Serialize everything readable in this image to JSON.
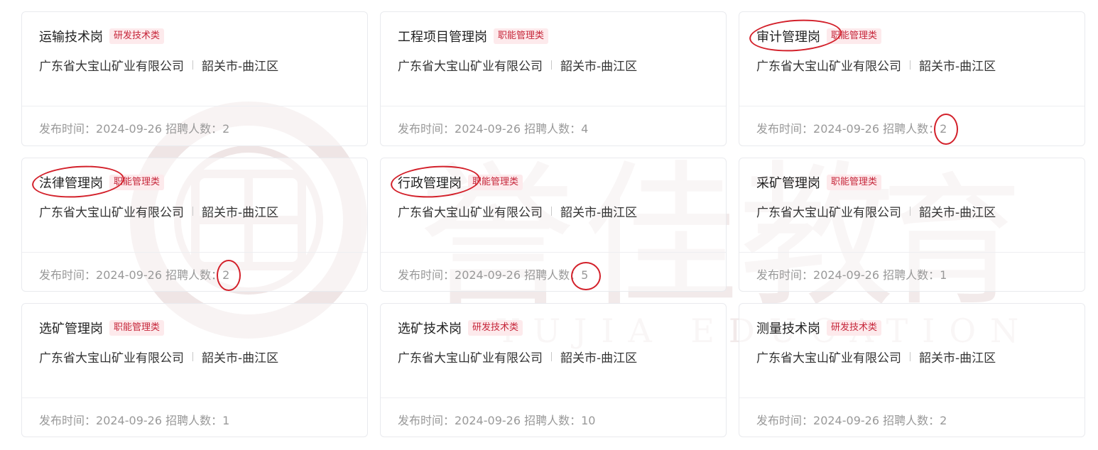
{
  "watermark": {
    "chars": [
      "誉",
      "佳",
      "教",
      "育"
    ],
    "latin": "YUJIA EDUCATION"
  },
  "colors": {
    "tag_text": "#c6263a",
    "tag_bg": "#fdeaec",
    "annotation": "#d3202a",
    "meta": "#999999"
  },
  "labels": {
    "publish_prefix": "发布时间：",
    "headcount_prefix": "招聘人数："
  },
  "jobs": [
    {
      "title": "运输技术岗",
      "tag": "研发技术类",
      "company": "广东省大宝山矿业有限公司",
      "location": "韶关市-曲江区",
      "date": "2024-09-26",
      "headcount": "2"
    },
    {
      "title": "工程项目管理岗",
      "tag": "职能管理类",
      "company": "广东省大宝山矿业有限公司",
      "location": "韶关市-曲江区",
      "date": "2024-09-26",
      "headcount": "4"
    },
    {
      "title": "审计管理岗",
      "tag": "职能管理类",
      "company": "广东省大宝山矿业有限公司",
      "location": "韶关市-曲江区",
      "date": "2024-09-26",
      "headcount": "2"
    },
    {
      "title": "法律管理岗",
      "tag": "职能管理类",
      "company": "广东省大宝山矿业有限公司",
      "location": "韶关市-曲江区",
      "date": "2024-09-26",
      "headcount": "2"
    },
    {
      "title": "行政管理岗",
      "tag": "职能管理类",
      "company": "广东省大宝山矿业有限公司",
      "location": "韶关市-曲江区",
      "date": "2024-09-26",
      "headcount": "5"
    },
    {
      "title": "采矿管理岗",
      "tag": "职能管理类",
      "company": "广东省大宝山矿业有限公司",
      "location": "韶关市-曲江区",
      "date": "2024-09-26",
      "headcount": "1"
    },
    {
      "title": "选矿管理岗",
      "tag": "职能管理类",
      "company": "广东省大宝山矿业有限公司",
      "location": "韶关市-曲江区",
      "date": "2024-09-26",
      "headcount": "1"
    },
    {
      "title": "选矿技术岗",
      "tag": "研发技术类",
      "company": "广东省大宝山矿业有限公司",
      "location": "韶关市-曲江区",
      "date": "2024-09-26",
      "headcount": "10"
    },
    {
      "title": "测量技术岗",
      "tag": "研发技术类",
      "company": "广东省大宝山矿业有限公司",
      "location": "韶关市-曲江区",
      "date": "2024-09-26",
      "headcount": "2"
    }
  ]
}
